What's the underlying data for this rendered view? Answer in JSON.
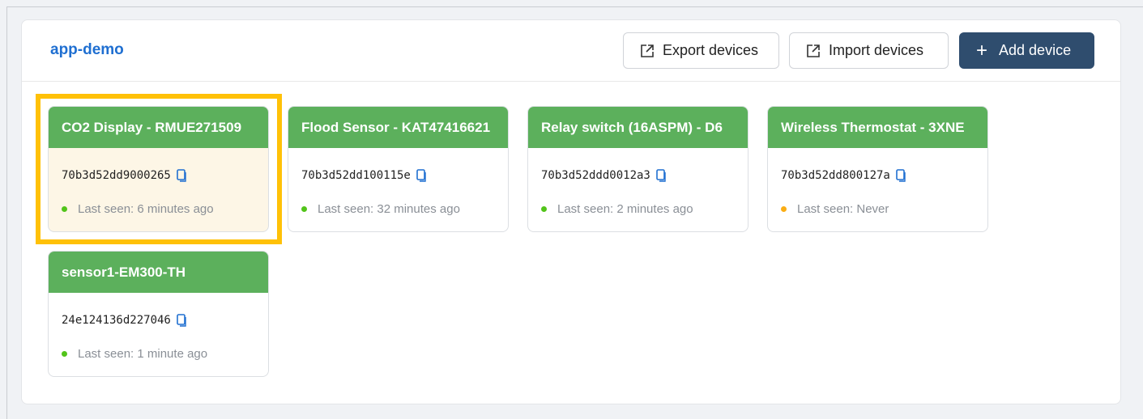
{
  "app": {
    "title": "app-demo"
  },
  "toolbar": {
    "export_label": "Export devices",
    "import_label": "Import devices",
    "add_label": "Add device"
  },
  "devices": [
    {
      "name": "CO2 Display - RMUE271509",
      "eui": "70b3d52dd9000265",
      "last_seen": "Last seen: 6 minutes ago",
      "status": "online"
    },
    {
      "name": "Flood Sensor - KAT47416621",
      "eui": "70b3d52dd100115e",
      "last_seen": "Last seen: 32 minutes ago",
      "status": "online"
    },
    {
      "name": "Relay switch (16ASPM) - D6",
      "eui": "70b3d52ddd0012a3",
      "last_seen": "Last seen: 2 minutes ago",
      "status": "online"
    },
    {
      "name": "Wireless Thermostat - 3XNE",
      "eui": "70b3d52dd800127a",
      "last_seen": "Last seen: Never",
      "status": "never"
    },
    {
      "name": "sensor1-EM300-TH",
      "eui": "24e124136d227046",
      "last_seen": "Last seen: 1 minute ago",
      "status": "online"
    }
  ],
  "colors": {
    "accent": "#1f6fd1",
    "card_header": "#5cb05c",
    "primary_button": "#2f4d6e",
    "highlight": "#ffc107",
    "status_online": "#52c41a",
    "status_never": "#faad14"
  },
  "icons": {
    "export": "export-icon",
    "import": "import-icon",
    "add": "plus-icon",
    "copy": "copy-icon"
  }
}
